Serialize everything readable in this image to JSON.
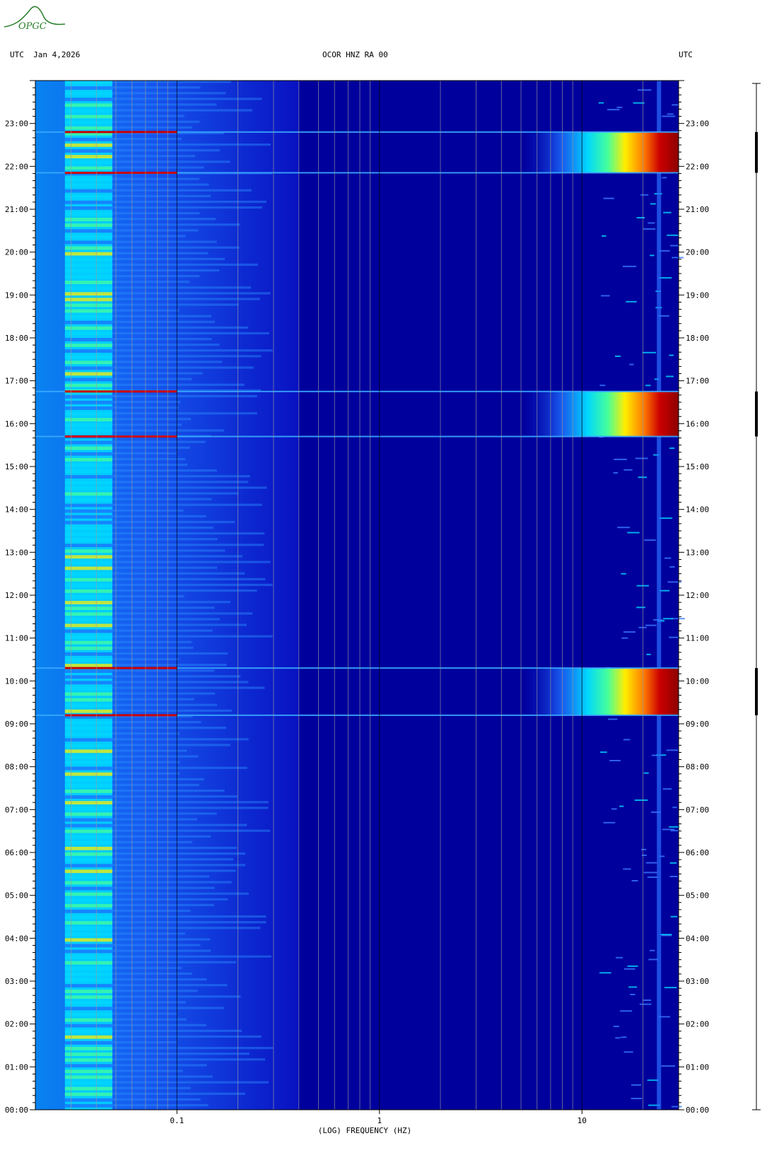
{
  "header": {
    "logo_text": "OPGC",
    "left_label": "UTC  Jan 4,2026",
    "center_label": "OCOR HNZ RA 00",
    "right_label": "UTC"
  },
  "colors": {
    "background": "#00009c",
    "low": "#0a14c8",
    "mid": "#00d7ff",
    "mid2": "#46ff9a",
    "high": "#ffee00",
    "peak": "#cc0000",
    "max": "#8b0000",
    "axis": "#000000",
    "grid": "#9a9a9a",
    "logo": "#2a7f2a"
  },
  "chart_data": {
    "type": "heatmap",
    "title": "OCOR HNZ RA 00",
    "xlabel": "(LOG) FREQUENCY (HZ)",
    "ylabel": "UTC",
    "x_scale": "log",
    "xlim": [
      0.02,
      30
    ],
    "x_ticks": [
      {
        "value": 0.1,
        "label": "0.1"
      },
      {
        "value": 1,
        "label": "1"
      },
      {
        "value": 10,
        "label": "10"
      }
    ],
    "ylim_hours": [
      0,
      24
    ],
    "y_ticks": [
      "00:00",
      "01:00",
      "02:00",
      "03:00",
      "04:00",
      "05:00",
      "06:00",
      "07:00",
      "08:00",
      "09:00",
      "10:00",
      "11:00",
      "12:00",
      "13:00",
      "14:00",
      "15:00",
      "16:00",
      "17:00",
      "18:00",
      "19:00",
      "20:00",
      "21:00",
      "22:00",
      "23:00"
    ],
    "grid_freqs": [
      0.03,
      0.04,
      0.05,
      0.06,
      0.07,
      0.08,
      0.09,
      0.1,
      0.2,
      0.3,
      0.4,
      0.5,
      0.6,
      0.7,
      0.8,
      0.9,
      1,
      2,
      3,
      4,
      5,
      6,
      7,
      8,
      9,
      10,
      20,
      30
    ],
    "high_frequency_energy_bursts_utc_hours": [
      {
        "start": 9.2,
        "end": 10.3
      },
      {
        "start": 15.7,
        "end": 16.75
      },
      {
        "start": 21.85,
        "end": 22.8
      }
    ],
    "broadband_lines_utc_hours": [
      9.2,
      10.3,
      15.7,
      16.75,
      21.85,
      22.8
    ],
    "persistent_band_hz": [
      0.028,
      0.048
    ],
    "persistent_line_hz": 24
  }
}
